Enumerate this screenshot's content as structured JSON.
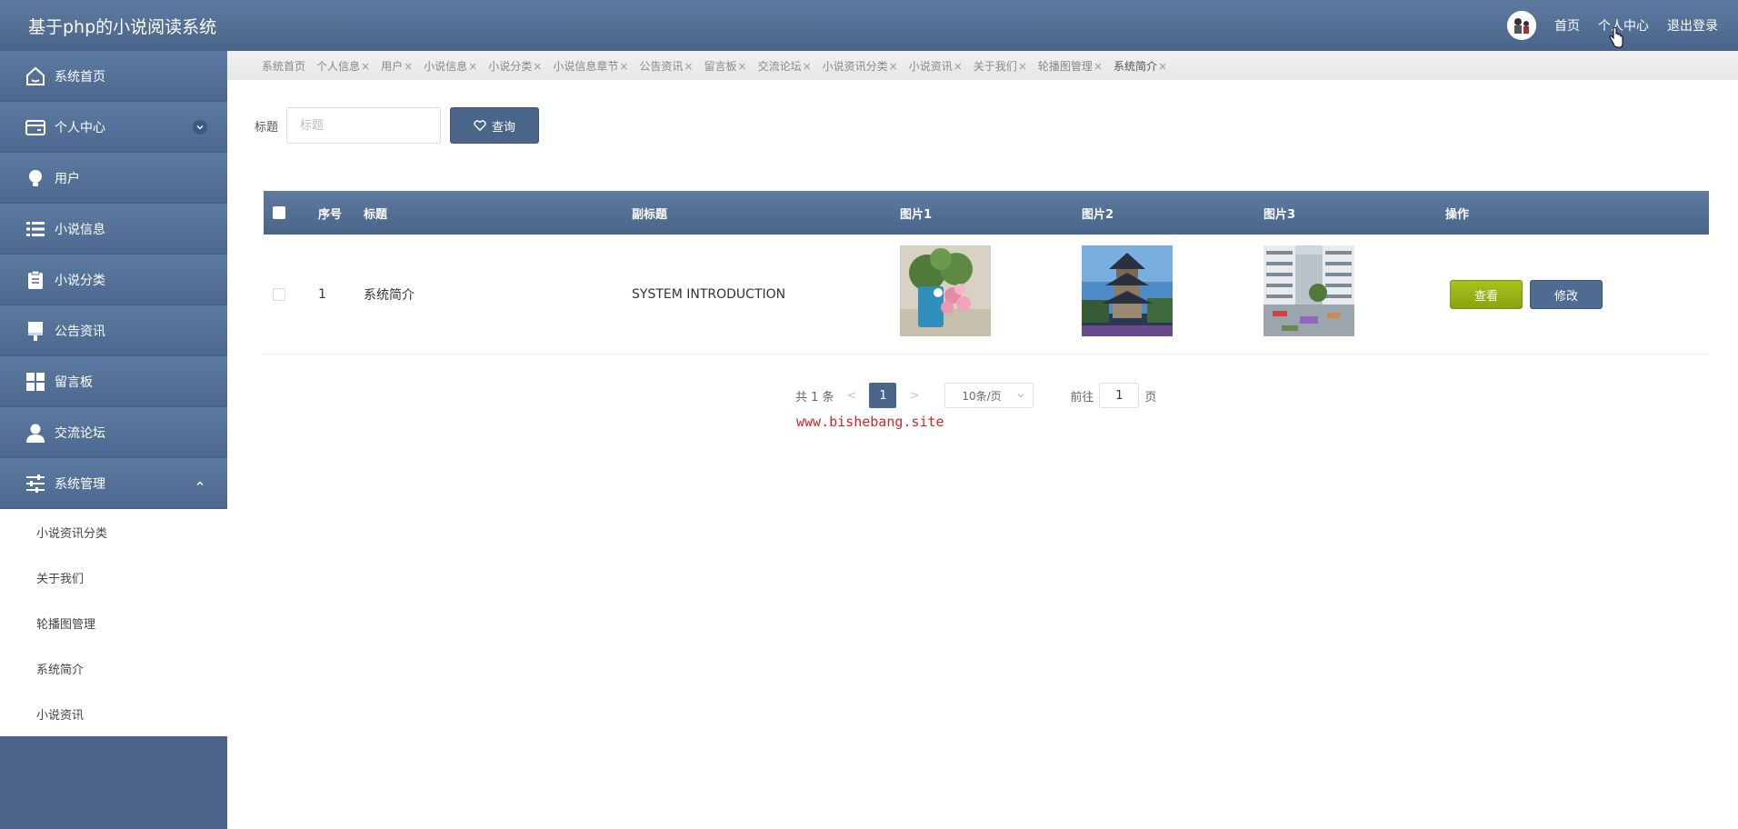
{
  "app": {
    "title": "基于php的小说阅读系统"
  },
  "topnav": {
    "home": "首页",
    "profile": "个人中心",
    "logout": "退出登录"
  },
  "sidebar": {
    "items": [
      {
        "label": "系统首页",
        "icon": "home-icon"
      },
      {
        "label": "个人中心",
        "icon": "wallet-icon"
      },
      {
        "label": "用户",
        "icon": "bulb-icon"
      },
      {
        "label": "小说信息",
        "icon": "list-icon"
      },
      {
        "label": "小说分类",
        "icon": "clipboard-icon"
      },
      {
        "label": "公告资讯",
        "icon": "brush-icon"
      },
      {
        "label": "留言板",
        "icon": "grid-icon"
      },
      {
        "label": "交流论坛",
        "icon": "user-icon"
      },
      {
        "label": "系统管理",
        "icon": "sliders-icon"
      }
    ],
    "submenu": [
      "小说资讯分类",
      "关于我们",
      "轮播图管理",
      "系统简介",
      "小说资讯"
    ]
  },
  "tabs": [
    "系统首页",
    "个人信息",
    "用户",
    "小说信息",
    "小说分类",
    "小说信息章节",
    "公告资讯",
    "留言板",
    "交流论坛",
    "小说资讯分类",
    "小说资讯",
    "关于我们",
    "轮播图管理",
    "系统简介"
  ],
  "tab_close": "×",
  "search": {
    "label": "标题",
    "placeholder": "标题",
    "value": "",
    "button": "查询"
  },
  "table": {
    "headers": {
      "index": "序号",
      "title": "标题",
      "subtitle": "副标题",
      "img1": "图片1",
      "img2": "图片2",
      "img3": "图片3",
      "actions": "操作"
    },
    "rows": [
      {
        "index": "1",
        "title": "系统简介",
        "subtitle": "SYSTEM INTRODUCTION",
        "view": "查看",
        "edit": "修改"
      }
    ]
  },
  "pagination": {
    "total": "共 1 条",
    "prev": "<",
    "page": "1",
    "next": ">",
    "size": "10条/页",
    "goto": "前往",
    "goto_value": "1",
    "page_unit": "页"
  },
  "watermark": "www.bishebang.site",
  "colors": {
    "primary": "#4a6589",
    "view_button": "#9bb518",
    "watermark": "#d0262b"
  }
}
